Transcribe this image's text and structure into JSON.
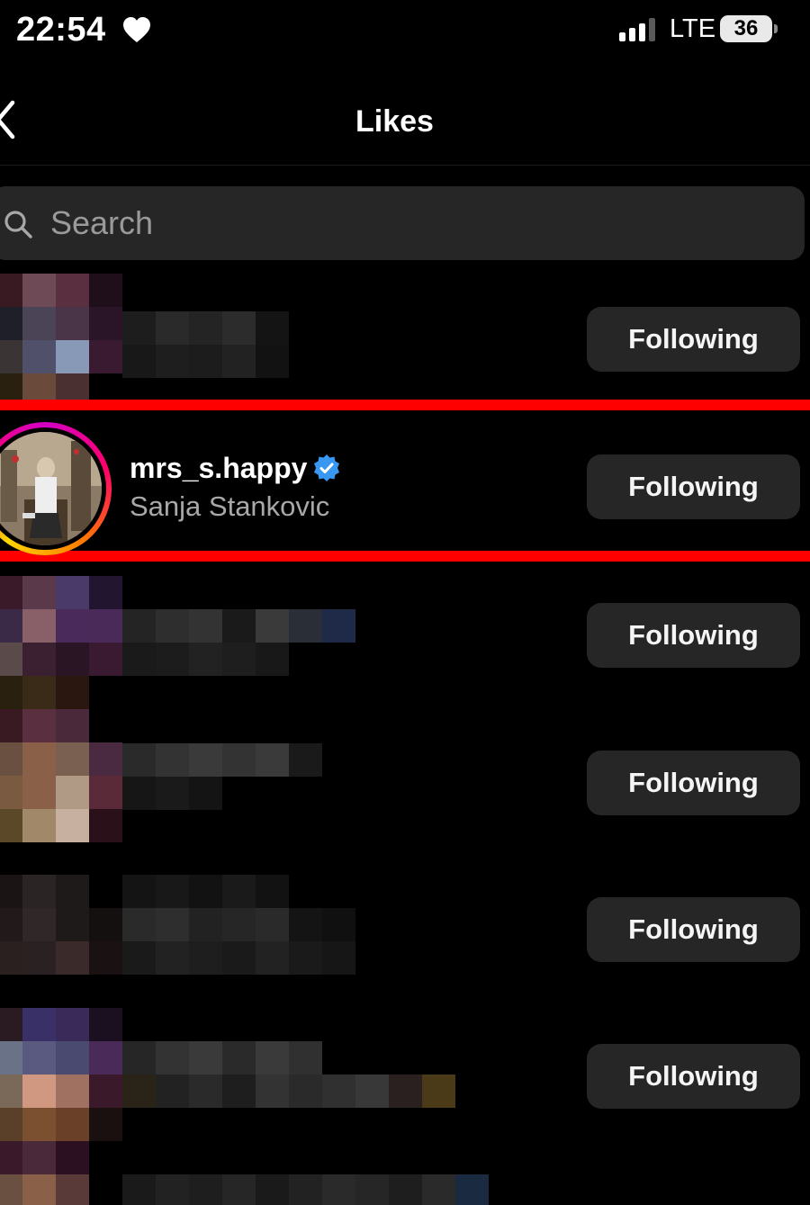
{
  "status_bar": {
    "time": "22:54",
    "network": "LTE",
    "battery": "36"
  },
  "header": {
    "title": "Likes"
  },
  "search": {
    "placeholder": "Search"
  },
  "highlighted_user": {
    "username": "mrs_s.happy",
    "full_name": "Sanja Stankovic",
    "verified": true
  },
  "rows": [
    {
      "button_label": "Following",
      "hidden": true
    },
    {
      "button_label": "Following",
      "hidden": false
    },
    {
      "button_label": "Following",
      "hidden": true
    },
    {
      "button_label": "Following",
      "hidden": true
    },
    {
      "button_label": "Following",
      "hidden": true
    },
    {
      "button_label": "Following",
      "hidden": true
    }
  ],
  "colors": {
    "background": "#000000",
    "button_bg": "#262626",
    "highlight_box": "#ff0000",
    "verified_badge": "#3897f0",
    "secondary_text": "#a8a8a8"
  },
  "icons": [
    "heart-icon",
    "signal-icon",
    "battery-icon",
    "back-arrow-icon",
    "search-icon",
    "verified-badge-icon"
  ]
}
